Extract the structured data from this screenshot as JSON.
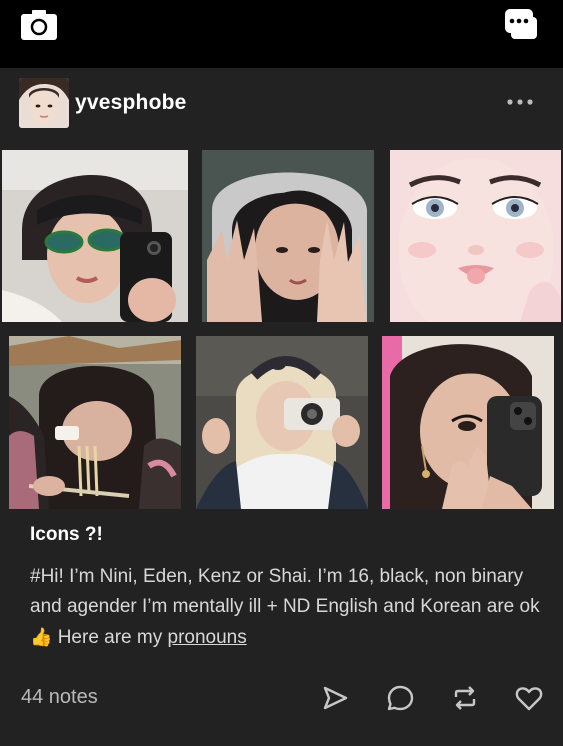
{
  "topbar": {
    "camera_icon": "camera-icon",
    "chat_icon": "chat-bubbles-icon"
  },
  "post": {
    "username": "yvesphobe",
    "more_icon": "ellipsis-icon",
    "title": "Icons ?!",
    "body_text": "#Hi! I’m Nini, Eden, Kenz or Shai. I’m 16, black, non binary and agender I’m mentally ill + ND English and Korean are ok",
    "thumbs_emoji": "👍",
    "body_tail": " Here are my ",
    "link_text": "pronouns",
    "notes": "44 notes",
    "actions": [
      "send-icon",
      "reply-icon",
      "reblog-icon",
      "like-icon"
    ]
  },
  "colors": {
    "background": "#000000",
    "card": "#222222",
    "text": "#ffffff",
    "muted": "#b9b9b9"
  }
}
